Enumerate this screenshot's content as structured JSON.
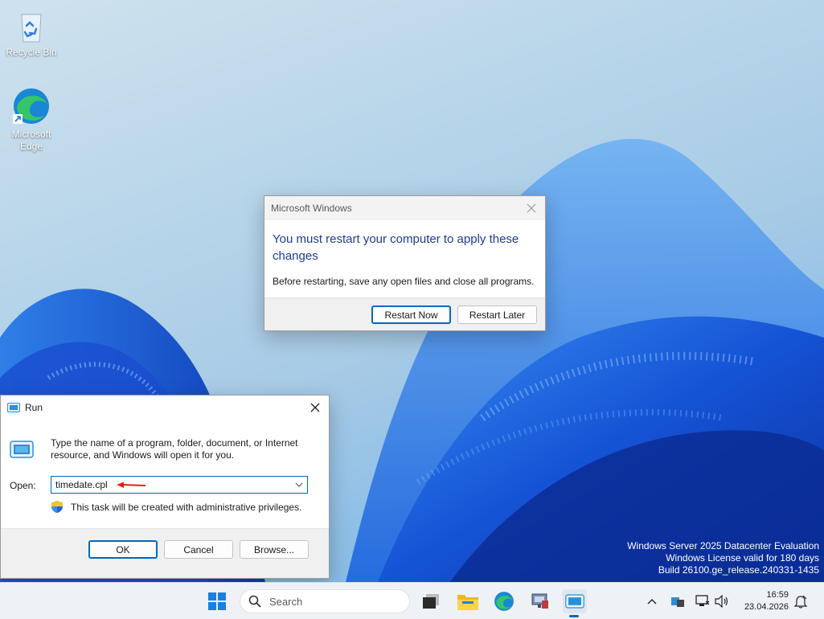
{
  "desktop": {
    "icons": [
      {
        "label": "Recycle Bin",
        "icon": "recycle-bin-icon"
      },
      {
        "label": "Microsoft Edge",
        "icon": "edge-icon"
      }
    ],
    "watermark": {
      "line1": "Windows Server 2025 Datacenter Evaluation",
      "line2": "Windows License valid for 180 days",
      "line3": "Build 26100.ge_release.240331-1435"
    }
  },
  "restart_dialog": {
    "title": "Microsoft Windows",
    "message": "You must restart your computer to apply these changes",
    "subtext": "Before restarting, save any open files and close all programs.",
    "restart_now_label": "Restart Now",
    "restart_later_label": "Restart Later"
  },
  "run_dialog": {
    "title": "Run",
    "description": "Type the name of a program, folder, document, or Internet resource, and Windows will open it for you.",
    "open_label": "Open:",
    "open_value": "timedate.cpl",
    "admin_note": "This task will be created with administrative privileges.",
    "ok_label": "OK",
    "cancel_label": "Cancel",
    "browse_label": "Browse..."
  },
  "taskbar": {
    "search_placeholder": "Search",
    "apps": [
      "start-icon",
      "task-view-icon",
      "file-explorer-icon",
      "edge-icon",
      "server-manager-icon",
      "run-icon"
    ],
    "time": "16:59",
    "date": "23.04.2026"
  },
  "colors": {
    "accent": "#0067c0",
    "restart_message": "#1f3a93",
    "arrow": "#e02020"
  }
}
